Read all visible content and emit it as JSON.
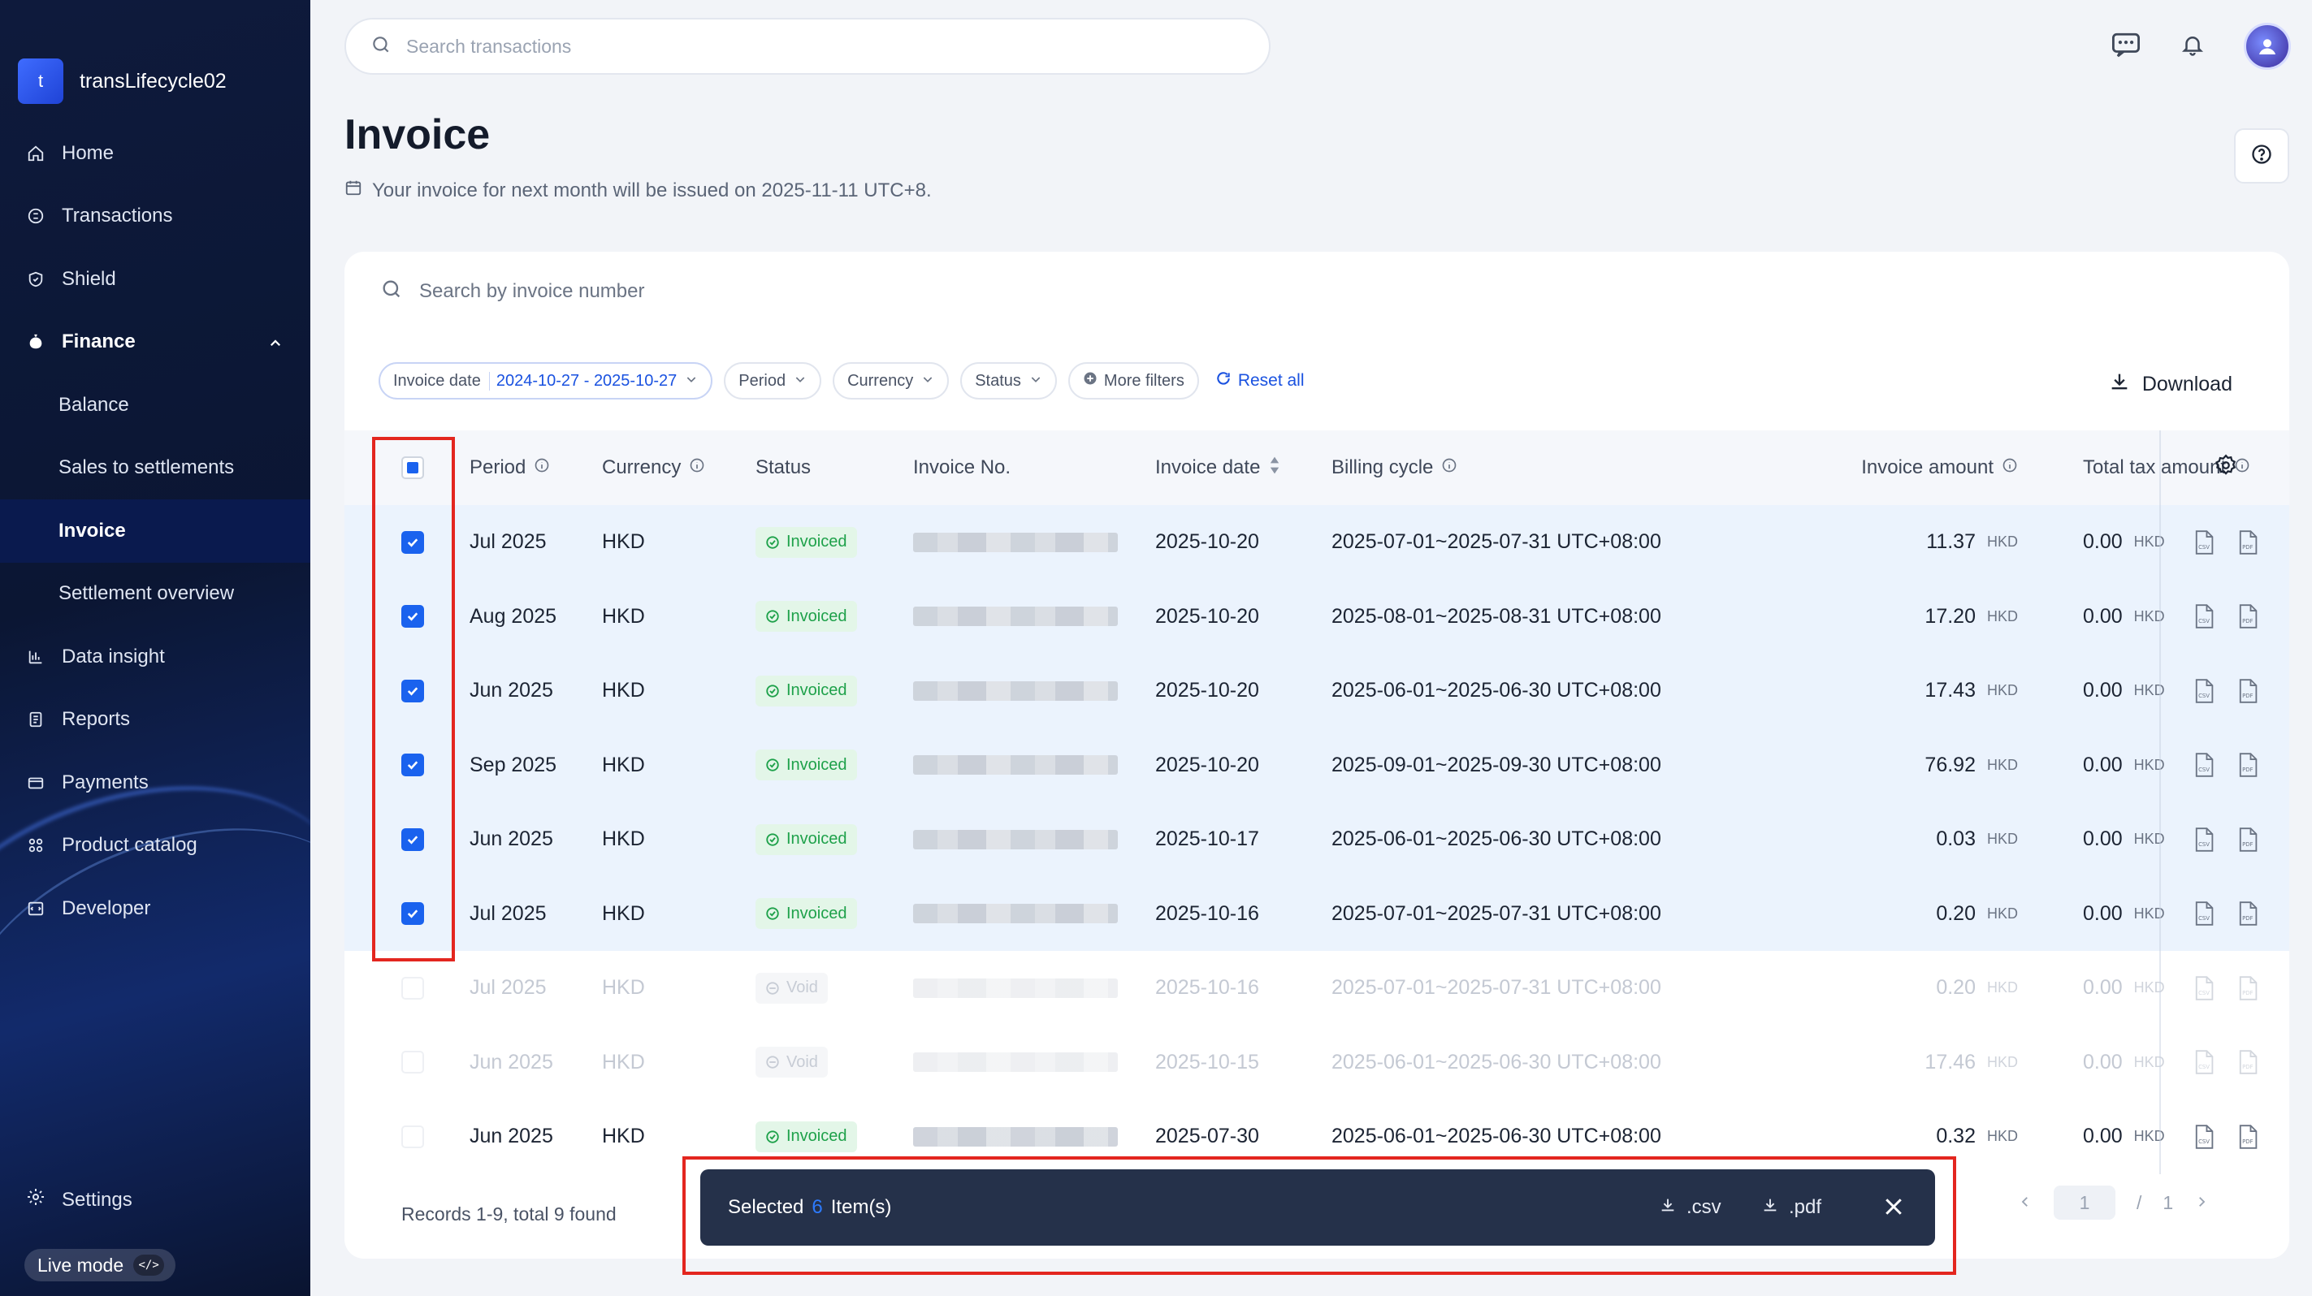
{
  "sidebar": {
    "merchant_initial": "t",
    "merchant_name": "transLifecycle02",
    "items": [
      {
        "label": "Home",
        "icon": "home-icon"
      },
      {
        "label": "Transactions",
        "icon": "transactions-icon"
      },
      {
        "label": "Shield",
        "icon": "shield-icon"
      },
      {
        "label": "Finance",
        "icon": "finance-icon"
      },
      {
        "label": "Balance"
      },
      {
        "label": "Sales to settlements"
      },
      {
        "label": "Invoice"
      },
      {
        "label": "Settlement overview"
      },
      {
        "label": "Data insight",
        "icon": "chart-icon"
      },
      {
        "label": "Reports",
        "icon": "reports-icon"
      },
      {
        "label": "Payments",
        "icon": "payments-icon"
      },
      {
        "label": "Product catalog",
        "icon": "catalog-icon"
      },
      {
        "label": "Developer",
        "icon": "developer-icon"
      }
    ],
    "settings_label": "Settings",
    "live_mode_label": "Live mode",
    "live_mode_code": "</>"
  },
  "topbar": {
    "search_placeholder": "Search transactions"
  },
  "page": {
    "title": "Invoice",
    "note": "Your invoice for next month will be issued on 2025-11-11 UTC+8."
  },
  "search": {
    "placeholder": "Search by invoice number"
  },
  "filters": {
    "invoice_date_label": "Invoice date",
    "invoice_date_value": "2024-10-27 - 2025-10-27",
    "period": "Period",
    "currency": "Currency",
    "status": "Status",
    "more_filters": "More filters",
    "reset_all": "Reset all",
    "download": "Download"
  },
  "table": {
    "columns": {
      "period": "Period",
      "currency": "Currency",
      "status": "Status",
      "invoice_no": "Invoice No.",
      "invoice_date": "Invoice date",
      "billing_cycle": "Billing cycle",
      "invoice_amount": "Invoice amount",
      "total_tax": "Total tax amount"
    },
    "rows": [
      {
        "period": "Jul 2025",
        "currency": "HKD",
        "status": "Invoiced",
        "date": "2025-10-20",
        "cycle": "2025-07-01~2025-07-31 UTC+08:00",
        "amount": "11.37",
        "amount_unit": "HKD",
        "tax": "0.00",
        "tax_unit": "HKD"
      },
      {
        "period": "Aug 2025",
        "currency": "HKD",
        "status": "Invoiced",
        "date": "2025-10-20",
        "cycle": "2025-08-01~2025-08-31 UTC+08:00",
        "amount": "17.20",
        "amount_unit": "HKD",
        "tax": "0.00",
        "tax_unit": "HKD"
      },
      {
        "period": "Jun 2025",
        "currency": "HKD",
        "status": "Invoiced",
        "date": "2025-10-20",
        "cycle": "2025-06-01~2025-06-30 UTC+08:00",
        "amount": "17.43",
        "amount_unit": "HKD",
        "tax": "0.00",
        "tax_unit": "HKD"
      },
      {
        "period": "Sep 2025",
        "currency": "HKD",
        "status": "Invoiced",
        "date": "2025-10-20",
        "cycle": "2025-09-01~2025-09-30 UTC+08:00",
        "amount": "76.92",
        "amount_unit": "HKD",
        "tax": "0.00",
        "tax_unit": "HKD"
      },
      {
        "period": "Jun 2025",
        "currency": "HKD",
        "status": "Invoiced",
        "date": "2025-10-17",
        "cycle": "2025-06-01~2025-06-30 UTC+08:00",
        "amount": "0.03",
        "amount_unit": "HKD",
        "tax": "0.00",
        "tax_unit": "HKD"
      },
      {
        "period": "Jul 2025",
        "currency": "HKD",
        "status": "Invoiced",
        "date": "2025-10-16",
        "cycle": "2025-07-01~2025-07-31 UTC+08:00",
        "amount": "0.20",
        "amount_unit": "HKD",
        "tax": "0.00",
        "tax_unit": "HKD"
      },
      {
        "period": "Jul 2025",
        "currency": "HKD",
        "status": "Void",
        "date": "2025-10-16",
        "cycle": "2025-07-01~2025-07-31 UTC+08:00",
        "amount": "0.20",
        "amount_unit": "HKD",
        "tax": "0.00",
        "tax_unit": "HKD"
      },
      {
        "period": "Jun 2025",
        "currency": "HKD",
        "status": "Void",
        "date": "2025-10-15",
        "cycle": "2025-06-01~2025-06-30 UTC+08:00",
        "amount": "17.46",
        "amount_unit": "HKD",
        "tax": "0.00",
        "tax_unit": "HKD"
      },
      {
        "period": "Jun 2025",
        "currency": "HKD",
        "status": "Invoiced",
        "date": "2025-07-30",
        "cycle": "2025-06-01~2025-06-30 UTC+08:00",
        "amount": "0.32",
        "amount_unit": "HKD",
        "tax": "0.00",
        "tax_unit": "HKD"
      }
    ]
  },
  "footer": {
    "records": "Records 1-9, total 9 found",
    "current_page": "1",
    "page_sep": "/",
    "total_pages": "1"
  },
  "selection_bar": {
    "prefix": "Selected",
    "count": "6",
    "suffix": "Item(s)",
    "csv": ".csv",
    "pdf": ".pdf"
  },
  "colors": {
    "accent": "#1a62ee",
    "sidebar_bg": "#0e1a3c",
    "invoiced_green": "#1ea14a",
    "highlight_red": "#e3261f"
  }
}
